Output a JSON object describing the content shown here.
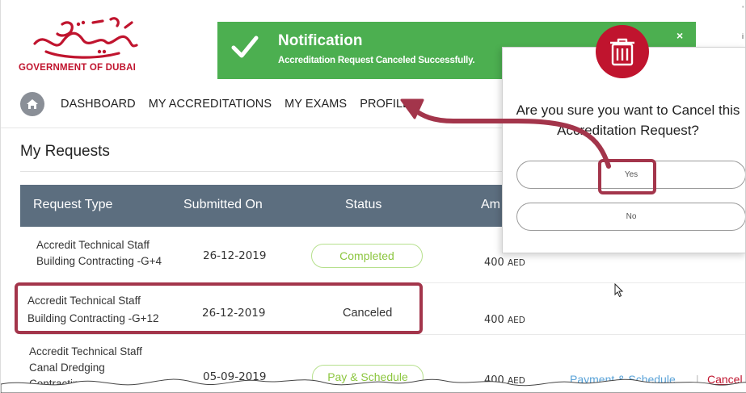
{
  "logo": {
    "text": "GOVERNMENT OF DUBAI"
  },
  "nav": {
    "items": [
      "DASHBOARD",
      "MY ACCREDITATIONS",
      "MY EXAMS",
      "PROFILE"
    ]
  },
  "page": {
    "title": "My Requests"
  },
  "table": {
    "headers": [
      "Request Type",
      "Submitted On",
      "Status",
      "Am"
    ],
    "rows": [
      {
        "type_line1": "Accredit Technical Staff",
        "type_line2": "Building Contracting -G+4",
        "submitted": "26-12-2019",
        "status": "Completed",
        "amount": "400",
        "currency": "AED"
      },
      {
        "type_line1": "Accredit Technical Staff",
        "type_line2": "Building Contracting -G+12",
        "submitted": "26-12-2019",
        "status": "Canceled",
        "amount": "400",
        "currency": "AED"
      },
      {
        "type_line1": "Accredit Technical Staff",
        "type_line2": "Canal Dredging",
        "type_line3": "Contracting-",
        "submitted": "05-09-2019",
        "status": "Pay & Schedule",
        "amount": "400",
        "currency": "AED",
        "action_link": "Payment & Schedule",
        "cancel_link": "Cancel"
      }
    ]
  },
  "notification": {
    "title": "Notification",
    "message": "Accreditation Request Canceled Successfully.",
    "close": "×"
  },
  "dialog": {
    "question": "Are you sure you want to Cancel this Accreditation Request?",
    "yes": "Yes",
    "no": "No"
  },
  "colors": {
    "accent_red": "#c0142e",
    "highlight": "#a3354b",
    "notification_green": "#4caf50",
    "table_header": "#5c6e7f",
    "pill_green": "#8cc63f",
    "link_blue": "#5aa3d8"
  }
}
